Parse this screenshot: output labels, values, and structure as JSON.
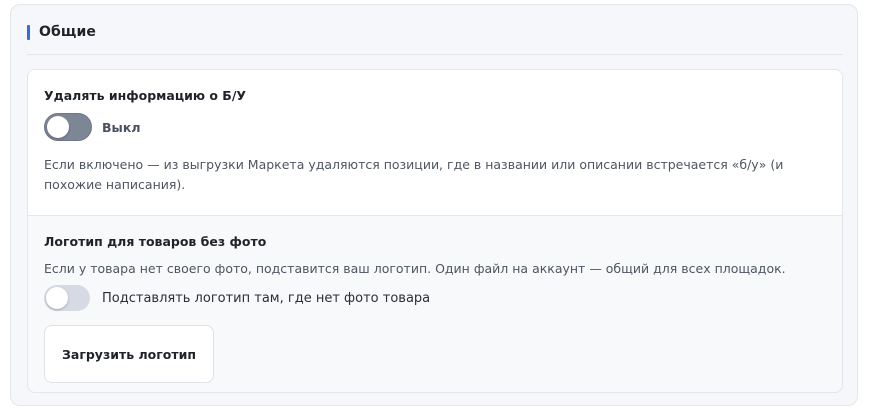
{
  "section": {
    "title": "Общие",
    "accent_color": "#2f6fd6"
  },
  "settings": {
    "remove_used": {
      "title": "Удалять информацию о Б/У",
      "toggle_on": false,
      "toggle_state_label": "Выкл",
      "description": "Если включено — из выгрузки Маркета удаляются позиции, где в названии или описании встречается «б/у» (и похожие написания)."
    },
    "logo": {
      "title": "Логотип для товаров без фото",
      "description": "Если у товара нет своего фото, подставится ваш логотип. Один файл на аккаунт — общий для всех площадок.",
      "toggle_on": false,
      "toggle_label": "Подставлять логотип там, где нет фото товара",
      "upload_button_label": "Загрузить логотип"
    }
  }
}
